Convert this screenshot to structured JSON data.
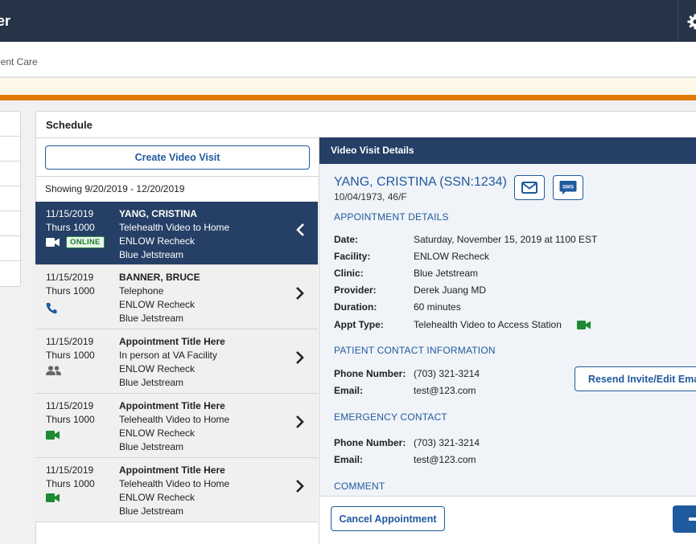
{
  "header": {
    "app_title": "er",
    "breadcrumb": "ient Care"
  },
  "schedule": {
    "title": "Schedule",
    "create_button": "Create Video Visit",
    "showing": "Showing 9/20/2019 - 12/20/2019",
    "appointments": [
      {
        "date": "11/15/2019",
        "time": "Thurs 1000",
        "name": "YANG, CRISTINA",
        "type": "Telehealth Video to Home",
        "facility": "ENLOW Recheck",
        "clinic": "Blue Jetstream",
        "icon": "video-icon",
        "badge": "ONLINE"
      },
      {
        "date": "11/15/2019",
        "time": "Thurs 1000",
        "name": "BANNER, BRUCE",
        "type": "Telephone",
        "facility": "ENLOW Recheck",
        "clinic": "Blue Jetstream",
        "icon": "phone-icon"
      },
      {
        "date": "11/15/2019",
        "time": "Thurs 1000",
        "name": "Appointment Title Here",
        "type": "In person at VA Facility",
        "facility": "ENLOW Recheck",
        "clinic": "Blue Jetstream",
        "icon": "people-icon"
      },
      {
        "date": "11/15/2019",
        "time": "Thurs 1000",
        "name": "Appointment Title Here",
        "type": "Telehealth Video to Home",
        "facility": "ENLOW Recheck",
        "clinic": "Blue Jetstream",
        "icon": "video-icon"
      },
      {
        "date": "11/15/2019",
        "time": "Thurs 1000",
        "name": "Appointment Title Here",
        "type": "Telehealth Video to Home",
        "facility": "ENLOW Recheck",
        "clinic": "Blue Jetstream",
        "icon": "video-icon"
      }
    ]
  },
  "details": {
    "header": "Video Visit Details",
    "patient_name": "YANG, CRISTINA (SSN:1234)",
    "patient_dob": "10/04/1973, 46/F",
    "sms_label": "SMS",
    "appointment_title": "APPOINTMENT DETAILS",
    "appointment": [
      {
        "label": "Date:",
        "value": "Saturday, November 15, 2019 at 1100 EST"
      },
      {
        "label": "Facility:",
        "value": "ENLOW Recheck"
      },
      {
        "label": "Clinic:",
        "value": "Blue Jetstream"
      },
      {
        "label": "Provider:",
        "value": "Derek Juang MD"
      },
      {
        "label": "Duration:",
        "value": "60 minutes"
      },
      {
        "label": "Appt Type:",
        "value": "Telehealth Video to Access Station"
      }
    ],
    "contact_title": "PATIENT CONTACT INFORMATION",
    "contact": [
      {
        "label": "Phone Number:",
        "value": "(703) 321-3214"
      },
      {
        "label": "Email:",
        "value": "test@123.com"
      }
    ],
    "resend_button": "Resend Invite/Edit Email",
    "emergency_title": "EMERGENCY CONTACT",
    "emergency": [
      {
        "label": "Phone Number:",
        "value": "(703) 321-3214"
      },
      {
        "label": "Email:",
        "value": "test@123.com"
      }
    ],
    "comment_title": "COMMENT",
    "cancel_button": "Cancel Appointment"
  },
  "colors": {
    "navy": "#253447",
    "selected": "#253f66",
    "accent": "#1f5a9e",
    "warning": "#e07b00",
    "video_green": "#1e8a33"
  }
}
